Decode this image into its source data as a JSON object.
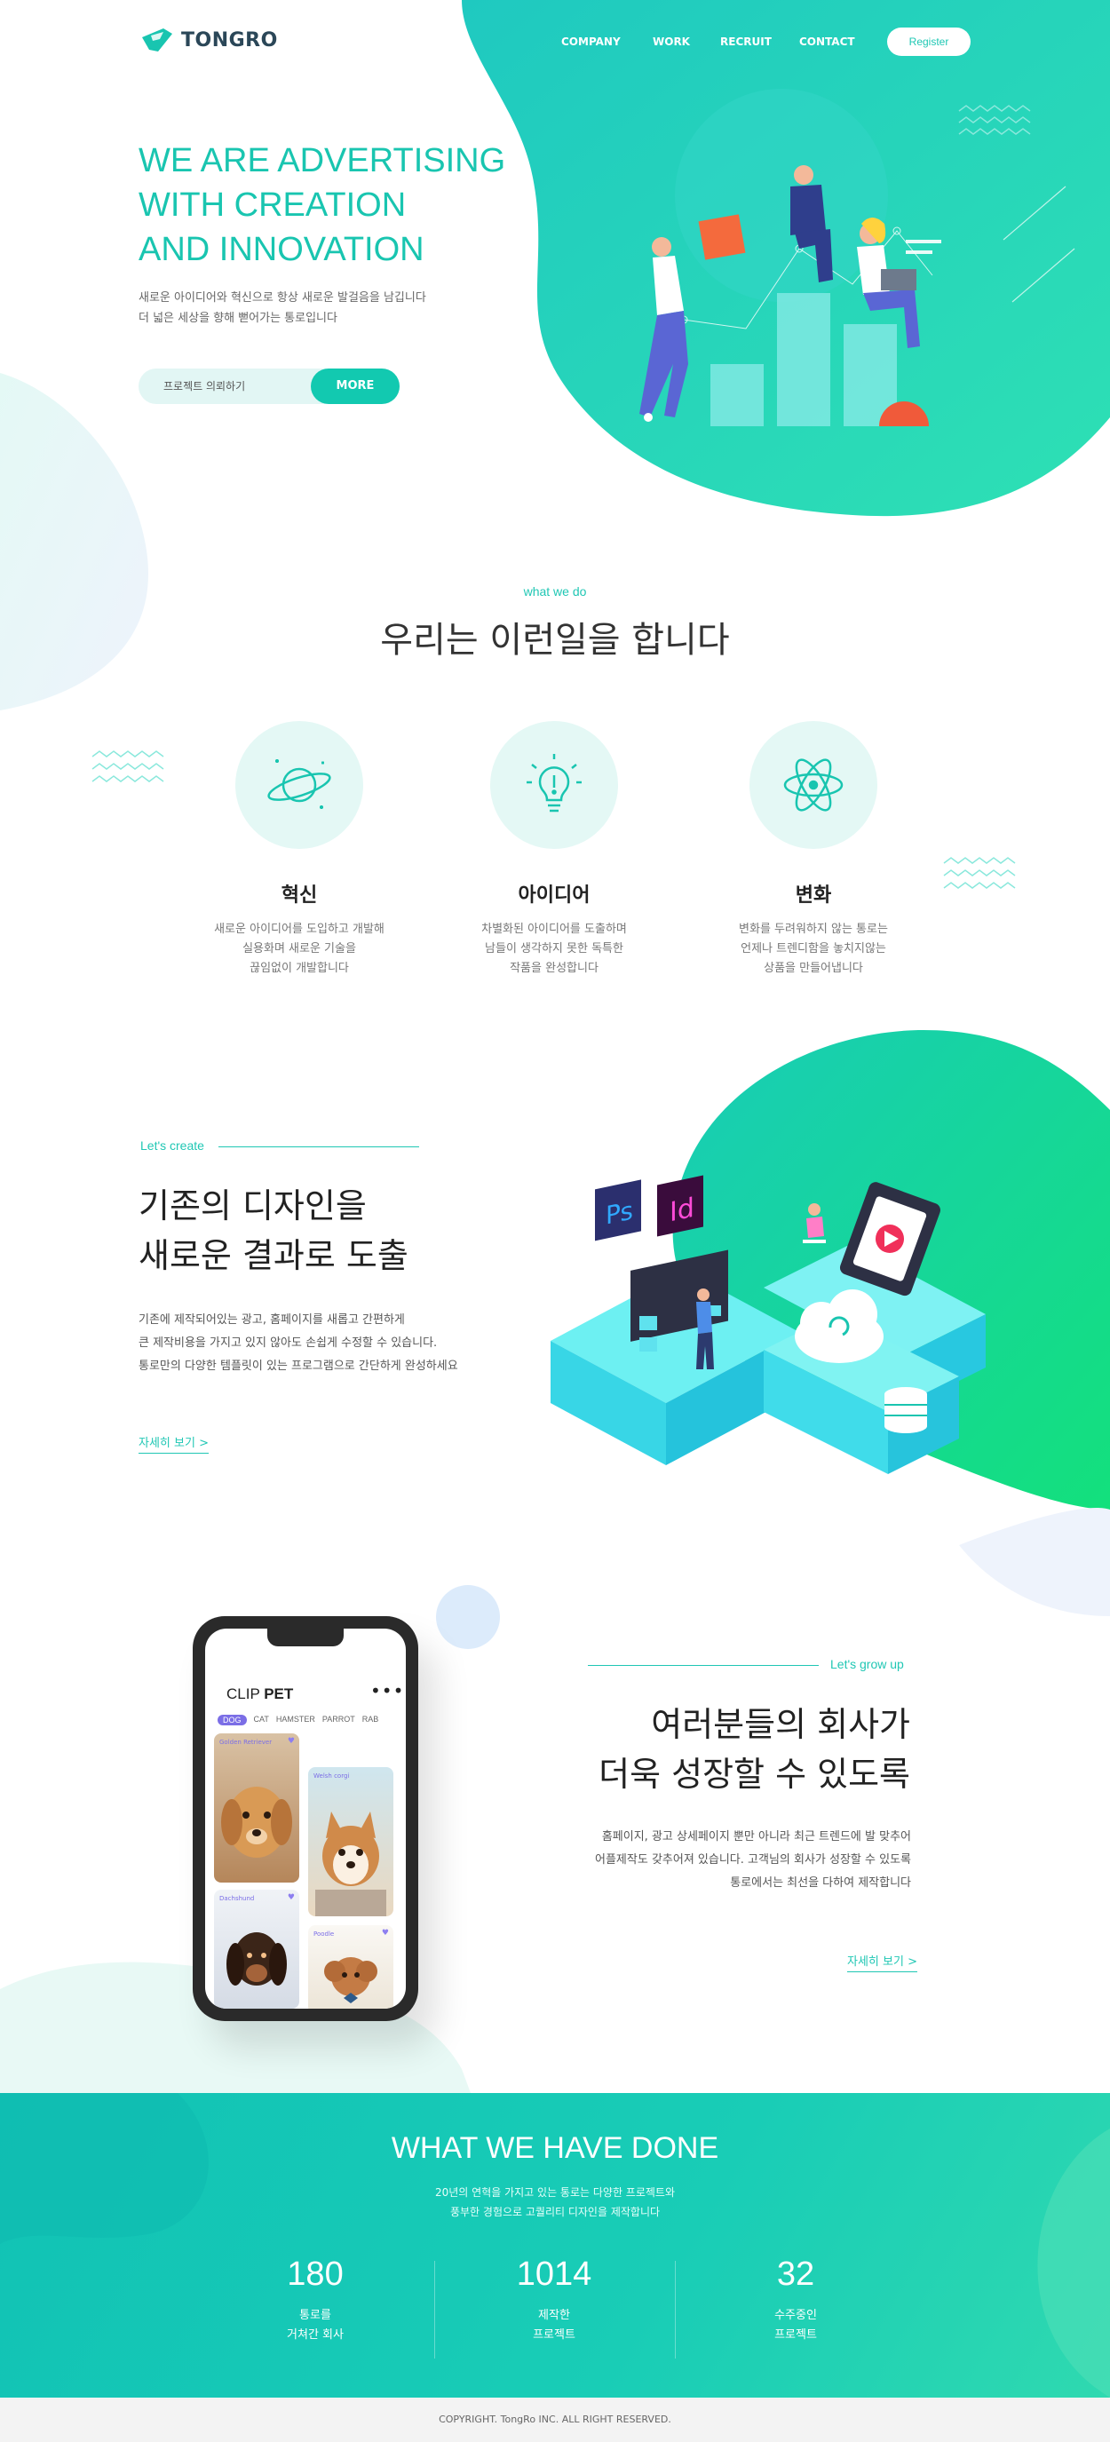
{
  "header": {
    "logo": "TONGRO",
    "nav": [
      "COMPANY",
      "WORK",
      "RECRUIT",
      "CONTACT"
    ],
    "register": "Register"
  },
  "hero": {
    "title": [
      "WE ARE ADVERTISING",
      "WITH CREATION",
      "AND INNOVATION"
    ],
    "desc": [
      "새로운 아이디어와 혁신으로 항상 새로운 발걸음을 남깁니다",
      "더 넓은 세상을 향해 뻗어가는 통로입니다"
    ],
    "input_text": "프로젝트 의뢰하기",
    "button": "MORE"
  },
  "what_we_do": {
    "label": "what we do",
    "title": "우리는 이런일을 합니다",
    "features": [
      {
        "title": "혁신",
        "desc": [
          "새로운 아이디어를 도입하고 개발해",
          "실용화며 새로운 기술을",
          "끊임없이 개발합니다"
        ],
        "icon": "planet-icon"
      },
      {
        "title": "아이디어",
        "desc": [
          "차별화된 아이디어를 도출하며",
          "남들이 생각하지 못한 독특한",
          "작품을 완성합니다"
        ],
        "icon": "lightbulb-icon"
      },
      {
        "title": "변화",
        "desc": [
          "변화를 두려워하지 않는 통로는",
          "언제나 트렌디함을 놓치지않는",
          "상품을 만들어냅니다"
        ],
        "icon": "atom-icon"
      }
    ]
  },
  "create": {
    "label": "Let's create",
    "title": [
      "기존의 디자인을",
      "새로운 결과로 도출"
    ],
    "desc": [
      "기존에 제작되어있는 광고, 홈페이지를 새롭고 간편하게",
      "큰 제작비용을 가지고 있지 않아도 손쉽게 수정할 수 있습니다.",
      "통로만의 다양한 템플릿이 있는 프로그램으로 간단하게 완성하세요"
    ],
    "link": "자세히 보기  >"
  },
  "grow": {
    "label": "Let's grow up",
    "title": [
      "여러분들의 회사가",
      "더욱 성장할 수 있도록"
    ],
    "desc": [
      "홈페이지, 광고 상세페이지 뿐만 아니라 최근 트렌드에 발 맞추어",
      "어플제작도 갖추어져 있습니다. 고객님의 회사가 성장할 수 있도록",
      "통로에서는 최선을 다하여 제작합니다"
    ],
    "link": "자세히 보기  >"
  },
  "phone_app": {
    "title_light": "CLIP ",
    "title_bold": "PET",
    "menu": "•••",
    "tabs": [
      "DOG",
      "CAT",
      "HAMSTER",
      "PARROT",
      "RAB"
    ],
    "cards": [
      "Golden Retriever",
      "Welsh corgi",
      "Dachshund",
      "Poodle"
    ]
  },
  "stats": {
    "title": "WHAT WE HAVE DONE",
    "desc": [
      "20년의 연혁을 가지고 있는 통로는 다양한 프로젝트와",
      "풍부한 경험으로 고퀄리티 디자인을 제작합니다"
    ],
    "items": [
      {
        "num": "180",
        "label": [
          "통로를",
          "거쳐간 회사"
        ]
      },
      {
        "num": "1014",
        "label": [
          "제작한",
          "프로젝트"
        ]
      },
      {
        "num": "32",
        "label": [
          "수주중인",
          "프로젝트"
        ]
      }
    ]
  },
  "footer": "COPYRIGHT. TongRo INC.  ALL RIGHT RESERVED.",
  "colors": {
    "accent": "#19c5b0",
    "accent_light": "#e4f8f5",
    "app_purple": "#7b6ee6"
  }
}
